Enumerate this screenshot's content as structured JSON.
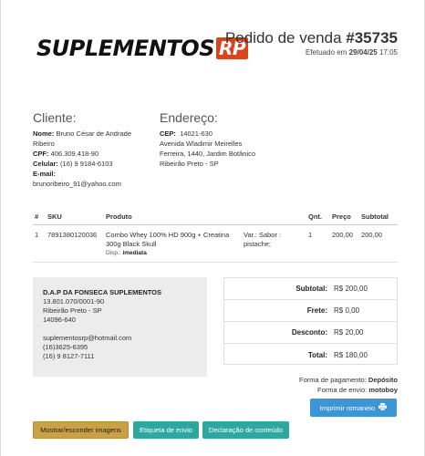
{
  "header": {
    "logo_text": "SUPLEMENTOS",
    "logo_badge": "RP",
    "order_label": "Pedido de venda",
    "order_number": "#35735",
    "date_label": "Efetuado em",
    "date_value": "29/04/25",
    "time_value": "17:05"
  },
  "client": {
    "title": "Cliente:",
    "name_label": "Nome:",
    "name_value": "Bruno César de Andrade Ribeiro",
    "cpf_label": "CPF:",
    "cpf_value": "406.309.418-90",
    "phone_label": "Celular:",
    "phone_value": "(16) 9 9184-6103",
    "email_label": "E-mail:",
    "email_value": "brunoribeiro_91@yahoo.com"
  },
  "address": {
    "title": "Endereço:",
    "cep_label": "CEP:",
    "cep_value": "14021-630",
    "line1": "Avenida Wladimir Meirelles",
    "line2": "Ferreira, 1440, Jardim Botânico",
    "line3": "Ribeirão Preto - SP"
  },
  "items_table": {
    "headers": [
      "#",
      "SKU",
      "Produto",
      "",
      "Qnt.",
      "Preço",
      "Subtotal"
    ],
    "rows": [
      {
        "num": "1",
        "sku": "7891380120036",
        "product": "Combo Whey 100% HD 900g + Creatina 300g Black Skull",
        "disp_label": "Disp.:",
        "disp_value": "imediata",
        "variation": "Var.: Sabor : pistache;",
        "qty": "1",
        "price": "200,00",
        "subtotal": "200,00"
      }
    ]
  },
  "company": {
    "name": "D.A.P DA FONSECA SUPLEMENTOS",
    "cnpj": "13.801.070/0001-90",
    "city": "Ribeirão Preto - SP",
    "cep": "14096-640",
    "email": "suplementosrp@hotmail.com",
    "phone1": "(16)3625-6395",
    "phone2": "(16) 9 8127-7111"
  },
  "totals": {
    "subtotal_label": "Subtotal:",
    "subtotal_value": "R$ 200,00",
    "frete_label": "Frete:",
    "frete_value": "R$ 0,00",
    "desconto_label": "Desconto:",
    "desconto_value": "R$ 20,00",
    "total_label": "Total:",
    "total_value": "R$ 180,00"
  },
  "payment": {
    "method_label": "Forma de pagamento:",
    "method_value": "Depósito",
    "shipping_label": "Forma de envio:",
    "shipping_value": "motoboy"
  },
  "buttons": {
    "print": "Imprimir romaneio",
    "print_icon": "printer-icon",
    "toggle_images": "Mostrar/esconder imagens",
    "shipping_label": "Etiqueta de envio",
    "content_declaration": "Declaração de conteúdo"
  },
  "colors": {
    "logo_badge": "#d9441c",
    "print_button": "#3c95d6",
    "toggle_images_button": "#caa147",
    "teal_buttons": "#2ea7a0"
  }
}
